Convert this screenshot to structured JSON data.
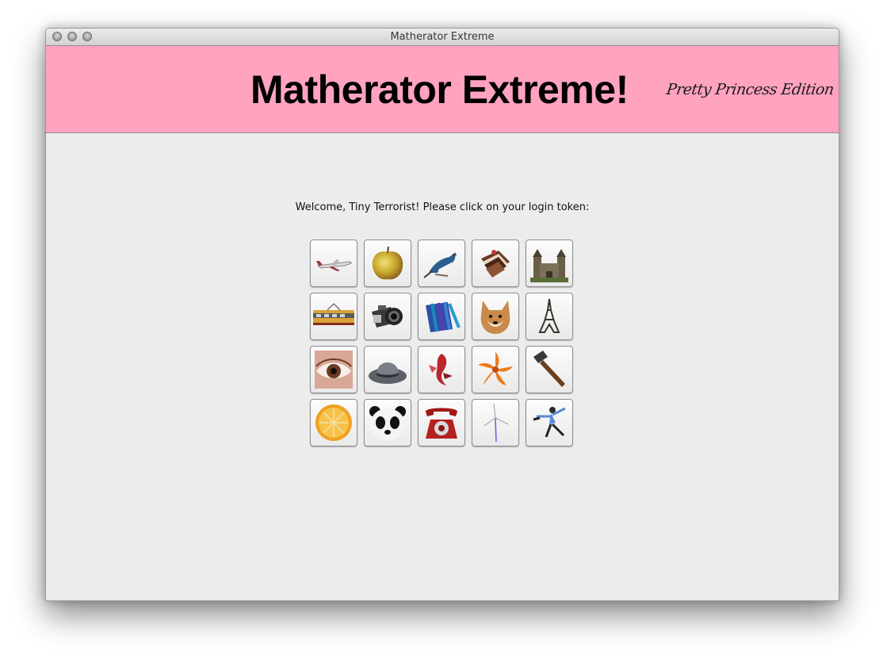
{
  "window": {
    "title": "Matherator Extreme"
  },
  "banner": {
    "title": "Matherator Extreme!",
    "subtitle": "Pretty Princess Edition",
    "background_color": "#ffa3bf"
  },
  "login": {
    "prompt": "Welcome, Tiny Terrorist! Please click on your login token:",
    "tokens": [
      {
        "icon": "airplane-icon"
      },
      {
        "icon": "apple-icon"
      },
      {
        "icon": "bird-icon"
      },
      {
        "icon": "cake-icon"
      },
      {
        "icon": "castle-icon"
      },
      {
        "icon": "tram-icon"
      },
      {
        "icon": "camera-icon"
      },
      {
        "icon": "crayons-icon"
      },
      {
        "icon": "dog-icon"
      },
      {
        "icon": "eiffel-tower-icon"
      },
      {
        "icon": "eye-icon"
      },
      {
        "icon": "hat-icon"
      },
      {
        "icon": "fish-icon"
      },
      {
        "icon": "lily-flower-icon"
      },
      {
        "icon": "hammer-icon"
      },
      {
        "icon": "orange-slice-icon"
      },
      {
        "icon": "panda-icon"
      },
      {
        "icon": "telephone-icon"
      },
      {
        "icon": "wind-turbine-icon"
      },
      {
        "icon": "skater-icon"
      }
    ]
  }
}
